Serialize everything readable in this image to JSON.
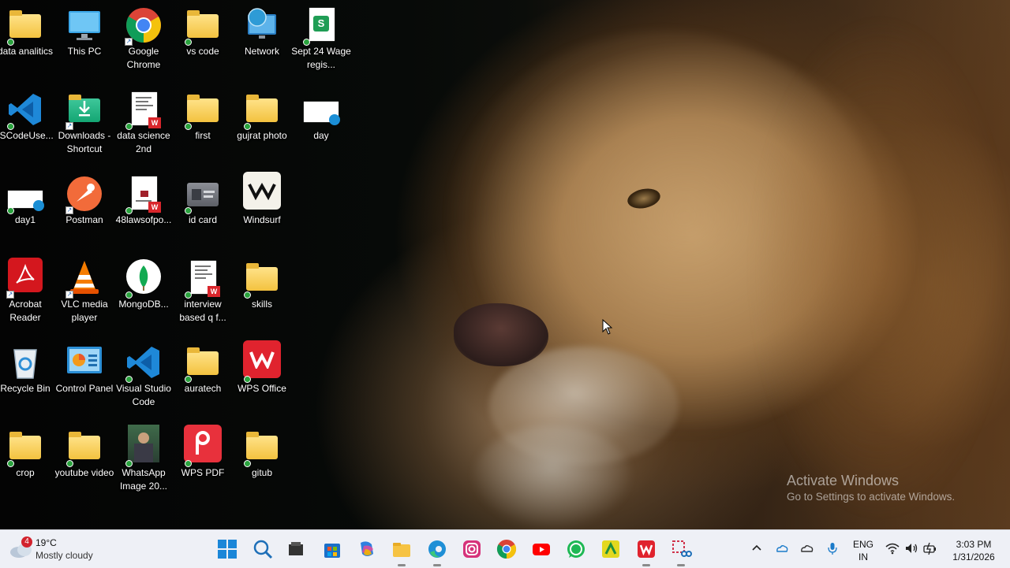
{
  "desktop": {
    "icons": [
      {
        "label": "data analitics",
        "icon": "folder-icon"
      },
      {
        "label": "This PC",
        "icon": "monitor-icon"
      },
      {
        "label": "Google Chrome",
        "icon": "chrome-icon"
      },
      {
        "label": "vs code",
        "icon": "folder-icon"
      },
      {
        "label": "Network",
        "icon": "network-globe-icon"
      },
      {
        "label": "Sept 24 Wage regis...",
        "icon": "spreadsheet-icon"
      },
      {
        "label": "/SCodeUse...",
        "icon": "vscode-icon"
      },
      {
        "label": "Downloads - Shortcut",
        "icon": "downloads-folder-icon"
      },
      {
        "label": "data science 2nd",
        "icon": "wps-document-icon"
      },
      {
        "label": "first",
        "icon": "folder-icon"
      },
      {
        "label": "gujrat photo",
        "icon": "folder-icon"
      },
      {
        "label": "day",
        "icon": "html-file-icon"
      },
      {
        "label": "day1",
        "icon": "html-file-icon"
      },
      {
        "label": "Postman",
        "icon": "postman-icon"
      },
      {
        "label": "48lawsofpo...",
        "icon": "wps-document-icon"
      },
      {
        "label": "id card",
        "icon": "id-card-icon"
      },
      {
        "label": "Windsurf",
        "icon": "windsurf-icon"
      },
      {
        "label": "Acrobat Reader",
        "icon": "acrobat-icon"
      },
      {
        "label": "VLC media player",
        "icon": "vlc-icon"
      },
      {
        "label": "MongoDB...",
        "icon": "mongodb-icon"
      },
      {
        "label": "interview based q f...",
        "icon": "wps-document-icon"
      },
      {
        "label": "skills",
        "icon": "folder-icon"
      },
      {
        "label": "Recycle Bin",
        "icon": "recycle-bin-icon"
      },
      {
        "label": "Control Panel",
        "icon": "control-panel-icon"
      },
      {
        "label": "Visual Studio Code",
        "icon": "vscode-icon"
      },
      {
        "label": "auratech",
        "icon": "folder-icon"
      },
      {
        "label": "WPS Office",
        "icon": "wps-office-icon"
      },
      {
        "label": "crop",
        "icon": "folder-icon"
      },
      {
        "label": "youtube video",
        "icon": "folder-icon"
      },
      {
        "label": "WhatsApp Image 20...",
        "icon": "image-file-icon"
      },
      {
        "label": "WPS PDF",
        "icon": "wps-pdf-icon"
      },
      {
        "label": "gitub",
        "icon": "folder-icon"
      }
    ]
  },
  "watermark": {
    "title": "Activate Windows",
    "subtitle": "Go to Settings to activate Windows."
  },
  "taskbar": {
    "weather": {
      "temp": "19°C",
      "condition": "Mostly cloudy",
      "badge": "4"
    },
    "apps": [
      "start-icon",
      "search-icon",
      "file-explorer-dark-icon",
      "microsoft-store-icon",
      "copilot-icon",
      "file-explorer-icon",
      "edge-icon",
      "instagram-icon",
      "chrome-icon",
      "youtube-icon",
      "whatsapp-icon",
      "excel-like-icon",
      "wps-office-icon",
      "snipping-tool-icon"
    ],
    "tray": {
      "language": "ENG",
      "region": "IN",
      "time": "3:03 PM",
      "date": "1/31/2026"
    }
  }
}
